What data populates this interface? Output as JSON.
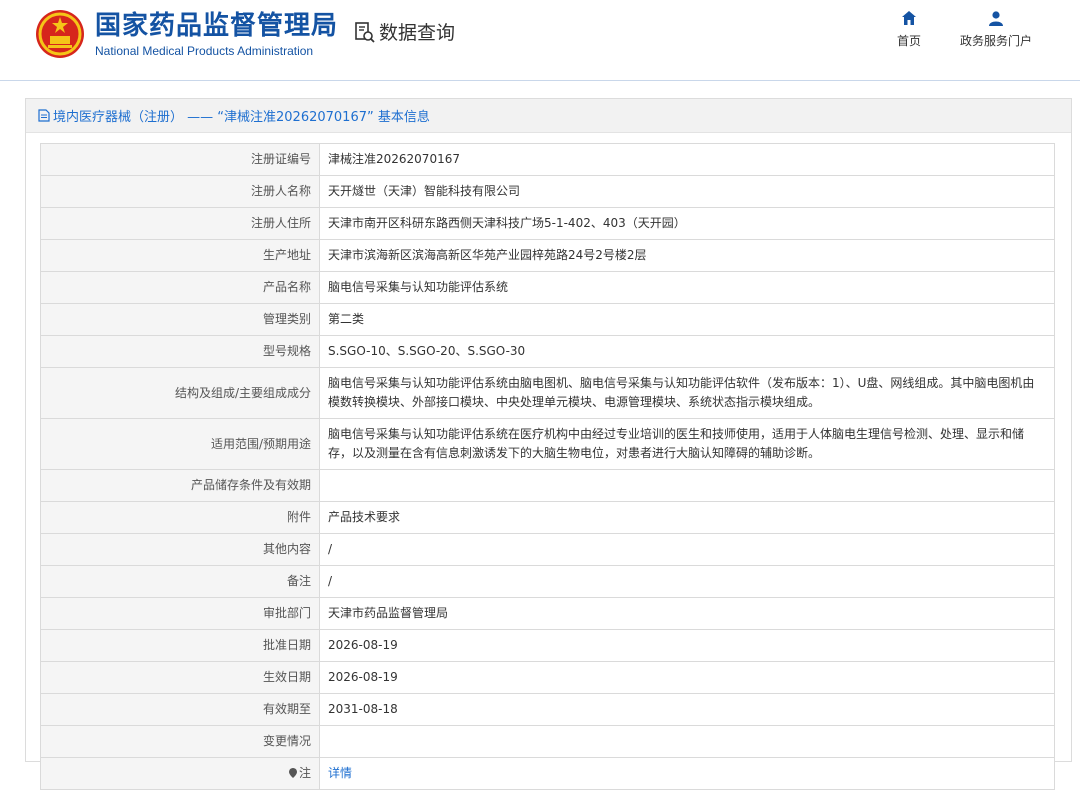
{
  "header": {
    "brand_cn": "国家药品监督管理局",
    "brand_en": "National Medical Products Administration",
    "query_label": "数据查询",
    "nav": [
      {
        "label": "首页",
        "icon": "home-icon"
      },
      {
        "label": "政务服务门户",
        "icon": "user-icon"
      }
    ]
  },
  "panel": {
    "title": "境内医疗器械（注册） —— “津械注准20262070167” 基本信息"
  },
  "rows": [
    {
      "key": "注册证编号",
      "value": "津械注准20262070167"
    },
    {
      "key": "注册人名称",
      "value": "天开燧世（天津）智能科技有限公司"
    },
    {
      "key": "注册人住所",
      "value": "天津市南开区科研东路西侧天津科技广场5-1-402、403（天开园）"
    },
    {
      "key": "生产地址",
      "value": "天津市滨海新区滨海高新区华苑产业园梓苑路24号2号楼2层"
    },
    {
      "key": "产品名称",
      "value": "脑电信号采集与认知功能评估系统"
    },
    {
      "key": "管理类别",
      "value": "第二类"
    },
    {
      "key": "型号规格",
      "value": "S.SGO-10、S.SGO-20、S.SGO-30"
    },
    {
      "key": "结构及组成/主要组成成分",
      "value": "脑电信号采集与认知功能评估系统由脑电图机、脑电信号采集与认知功能评估软件（发布版本：1）、U盘、网线组成。其中脑电图机由模数转换模块、外部接口模块、中央处理单元模块、电源管理模块、系统状态指示模块组成。"
    },
    {
      "key": "适用范围/预期用途",
      "value": "脑电信号采集与认知功能评估系统在医疗机构中由经过专业培训的医生和技师使用，适用于人体脑电生理信号检测、处理、显示和储存，以及测量在含有信息刺激诱发下的大脑生物电位，对患者进行大脑认知障碍的辅助诊断。"
    },
    {
      "key": "产品储存条件及有效期",
      "value": ""
    },
    {
      "key": "附件",
      "value": "产品技术要求"
    },
    {
      "key": "其他内容",
      "value": "/"
    },
    {
      "key": "备注",
      "value": "/"
    },
    {
      "key": "审批部门",
      "value": "天津市药品监督管理局"
    },
    {
      "key": "批准日期",
      "value": "2026-08-19"
    },
    {
      "key": "生效日期",
      "value": "2026-08-19"
    },
    {
      "key": "有效期至",
      "value": "2031-08-18"
    },
    {
      "key": "变更情况",
      "value": ""
    }
  ],
  "note": {
    "key": "注",
    "link": "详情"
  },
  "colors": {
    "brand": "#1453a3",
    "link": "#1e6fd0"
  }
}
